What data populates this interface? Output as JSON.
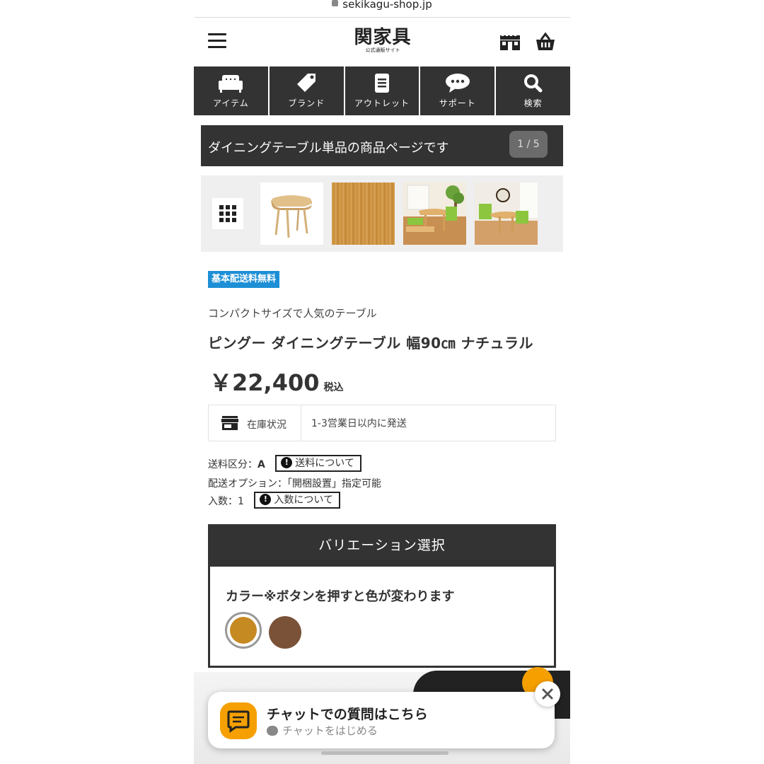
{
  "browser": {
    "url": "sekikagu-shop.jp"
  },
  "header": {
    "logo_main": "関家具",
    "logo_sub": "公式通販サイト"
  },
  "nav": [
    {
      "label": "アイテム",
      "icon": "sofa-icon"
    },
    {
      "label": "ブランド",
      "icon": "tag-icon"
    },
    {
      "label": "アウトレット",
      "icon": "document-icon"
    },
    {
      "label": "サポート",
      "icon": "chat-bubble-icon"
    },
    {
      "label": "検索",
      "icon": "search-icon"
    }
  ],
  "banner": {
    "title": "ダイニングテーブル単品の商品ページです",
    "pager": "1 / 5"
  },
  "thumbnails": [
    "table-photo",
    "wood-grain-photo",
    "dining-room-photo-1",
    "dining-room-photo-2"
  ],
  "product": {
    "badge": "基本配送料無料",
    "catchcopy": "コンパクトサイズで人気のテーブル",
    "name": "ピングー ダイニングテーブル 幅90㎝ ナチュラル",
    "price": "￥22,400",
    "tax_label": "税込"
  },
  "stock": {
    "label": "在庫状況",
    "value": "1-3営業日以内に発送"
  },
  "shipping": {
    "class_label": "送料区分：",
    "class_value": "A",
    "fee_button": "送料について",
    "option": "配送オプション：「開梱設置」指定可能",
    "qty_label": "入数：",
    "qty_value": "1",
    "qty_button": "入数について"
  },
  "variation": {
    "header": "バリエーション選択",
    "color_title": "カラー※ボタンを押すと色が変わります",
    "swatches": [
      {
        "name": "natural",
        "color": "#c68a22",
        "selected": true
      },
      {
        "name": "brown",
        "color": "#7a5238",
        "selected": false
      }
    ]
  },
  "chat": {
    "title": "チャットでの質問はこちら",
    "subtitle": "チャットをはじめる"
  },
  "colors": {
    "dark": "#333333",
    "badge_blue": "#1d8fd6",
    "chat_orange": "#f5a000"
  }
}
